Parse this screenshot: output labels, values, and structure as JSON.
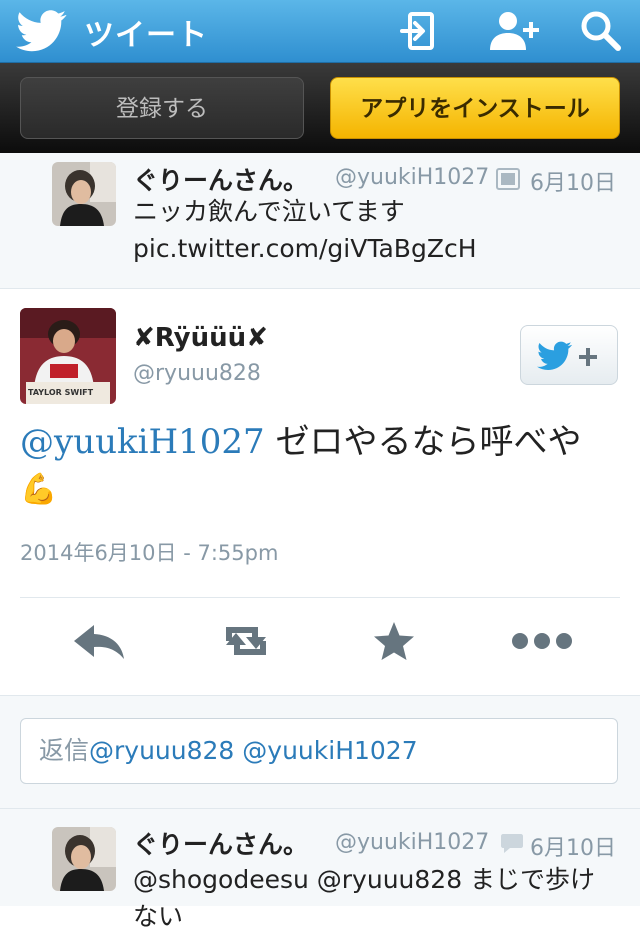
{
  "header": {
    "title": "ツイート"
  },
  "signup": {
    "register_label": "登録する",
    "install_label": "アプリをインストール"
  },
  "prev_tweet": {
    "name": "ぐりーんさん。",
    "handle": "@yuukiH1027",
    "date": "6月10日",
    "text_line1": "ニッカ飲んで泣いてます",
    "text_line2": "pic.twitter.com/giVTaBgZcH"
  },
  "main_tweet": {
    "name": "✘Rÿüüü✘",
    "handle": "@ryuuu828",
    "mention": "@yuukiH1027",
    "text": " ゼロやるなら呼べや",
    "emoji": "💪",
    "timestamp": "2014年6月10日 - 7:55pm",
    "avatar_caption": "TAYLOR SWIFT"
  },
  "reply": {
    "prefix": "返信",
    "mentions": "@ryuuu828 @yuukiH1027"
  },
  "next_tweet": {
    "name": "ぐりーんさん。",
    "handle": "@yuukiH1027",
    "date": "6月10日",
    "text": "@shogodeesu @ryuuu828 まじで歩け",
    "text_line2": "ない"
  },
  "colors": {
    "header_blue": "#3a9ad9",
    "link_blue": "#2b7bb9",
    "install_yellow": "#f9c21a"
  }
}
